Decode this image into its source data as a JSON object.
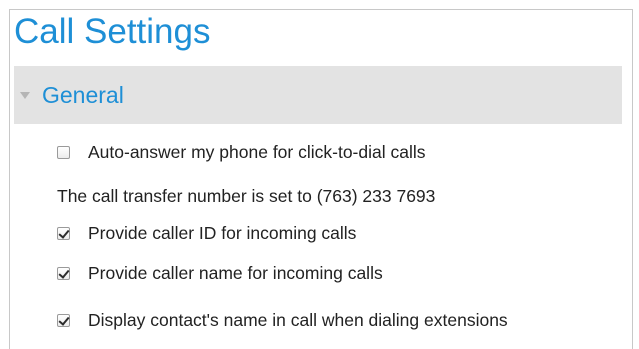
{
  "page": {
    "title": "Call Settings"
  },
  "section": {
    "title": "General",
    "expanded": true
  },
  "settings": {
    "auto_answer": {
      "label": "Auto-answer my phone for click-to-dial calls",
      "checked": false
    },
    "transfer_text": "The call transfer number is set to (763) 233 7693",
    "caller_id": {
      "label": "Provide caller ID for incoming calls",
      "checked": true
    },
    "caller_name": {
      "label": "Provide caller name for incoming calls",
      "checked": true
    },
    "contact_name": {
      "label": "Display contact's name in call when dialing extensions",
      "checked": true
    }
  },
  "colors": {
    "accent": "#1e8fd6",
    "section_bg": "#e3e3e3",
    "text": "#222222"
  },
  "icons": {
    "section_toggle": "chevron-down-icon"
  }
}
